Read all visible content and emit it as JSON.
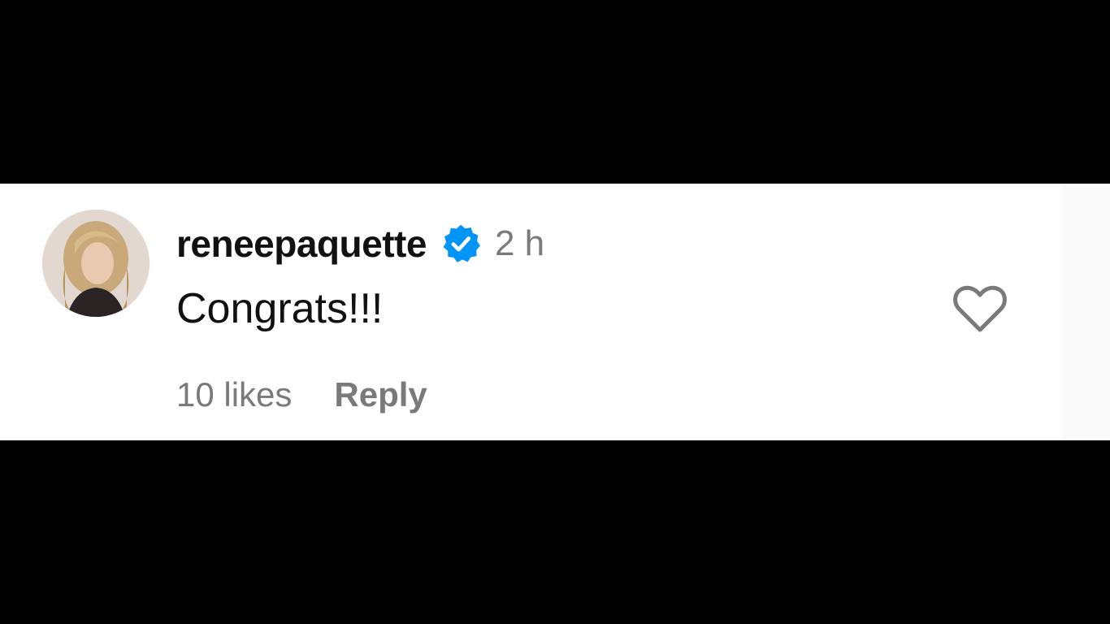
{
  "comment": {
    "username": "reneepaquette",
    "verified": true,
    "timestamp": "2 h",
    "text": "Congrats!!!",
    "likes_label": "10 likes",
    "reply_label": "Reply"
  },
  "icons": {
    "verified_badge": "verified-badge-icon",
    "like": "heart-outline-icon"
  },
  "colors": {
    "background": "#000000",
    "card": "#ffffff",
    "verified": "#0095f6",
    "secondary_text": "#7a7a7a",
    "primary_text": "#111111"
  }
}
